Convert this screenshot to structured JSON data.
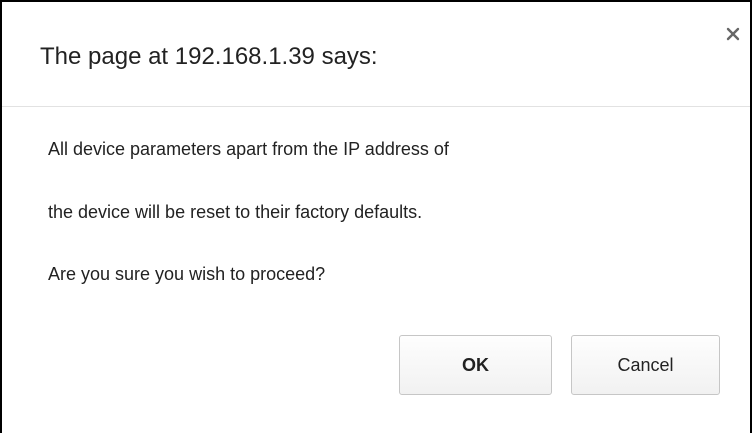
{
  "dialog": {
    "title": "The page at 192.168.1.39 says:",
    "close_icon": "close-icon",
    "message_lines": [
      "All device parameters apart from the IP address of",
      "the device will be reset to their factory defaults.",
      "Are you sure you wish to proceed?"
    ],
    "ok_label": "OK",
    "cancel_label": "Cancel"
  }
}
